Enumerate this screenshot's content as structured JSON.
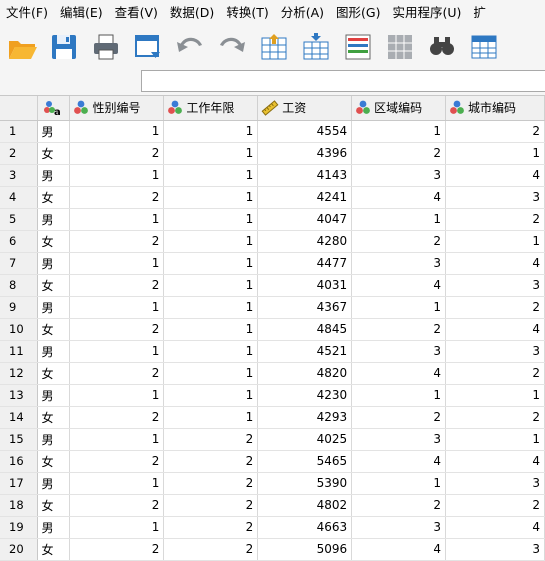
{
  "menu": [
    "文件(F)",
    "编辑(E)",
    "查看(V)",
    "数据(D)",
    "转换(T)",
    "分析(A)",
    "图形(G)",
    "实用程序(U)",
    "扩"
  ],
  "toolbar": [
    {
      "name": "open-folder-icon"
    },
    {
      "name": "save-icon"
    },
    {
      "name": "print-icon"
    },
    {
      "name": "dialog-recall-icon"
    },
    {
      "name": "undo-icon"
    },
    {
      "name": "redo-icon"
    },
    {
      "name": "goto-case-icon"
    },
    {
      "name": "goto-variable-icon"
    },
    {
      "name": "variables-icon"
    },
    {
      "name": "insert-cases-icon"
    },
    {
      "name": "find-icon"
    },
    {
      "name": "split-file-icon"
    }
  ],
  "columns": [
    {
      "label": "",
      "type": "string-nominal"
    },
    {
      "label": "性别编号",
      "type": "nominal"
    },
    {
      "label": "工作年限",
      "type": "nominal"
    },
    {
      "label": "工资",
      "type": "scale"
    },
    {
      "label": "区域编码",
      "type": "nominal"
    },
    {
      "label": "城市编码",
      "type": "nominal"
    }
  ],
  "rows": [
    {
      "n": "1",
      "c": [
        "男",
        "1",
        "1",
        "4554",
        "1",
        "2"
      ]
    },
    {
      "n": "2",
      "c": [
        "女",
        "2",
        "1",
        "4396",
        "2",
        "1"
      ]
    },
    {
      "n": "3",
      "c": [
        "男",
        "1",
        "1",
        "4143",
        "3",
        "4"
      ]
    },
    {
      "n": "4",
      "c": [
        "女",
        "2",
        "1",
        "4241",
        "4",
        "3"
      ]
    },
    {
      "n": "5",
      "c": [
        "男",
        "1",
        "1",
        "4047",
        "1",
        "2"
      ]
    },
    {
      "n": "6",
      "c": [
        "女",
        "2",
        "1",
        "4280",
        "2",
        "1"
      ]
    },
    {
      "n": "7",
      "c": [
        "男",
        "1",
        "1",
        "4477",
        "3",
        "4"
      ]
    },
    {
      "n": "8",
      "c": [
        "女",
        "2",
        "1",
        "4031",
        "4",
        "3"
      ]
    },
    {
      "n": "9",
      "c": [
        "男",
        "1",
        "1",
        "4367",
        "1",
        "2"
      ]
    },
    {
      "n": "10",
      "c": [
        "女",
        "2",
        "1",
        "4845",
        "2",
        "4"
      ]
    },
    {
      "n": "11",
      "c": [
        "男",
        "1",
        "1",
        "4521",
        "3",
        "3"
      ]
    },
    {
      "n": "12",
      "c": [
        "女",
        "2",
        "1",
        "4820",
        "4",
        "2"
      ]
    },
    {
      "n": "13",
      "c": [
        "男",
        "1",
        "1",
        "4230",
        "1",
        "1"
      ]
    },
    {
      "n": "14",
      "c": [
        "女",
        "2",
        "1",
        "4293",
        "2",
        "2"
      ]
    },
    {
      "n": "15",
      "c": [
        "男",
        "1",
        "2",
        "4025",
        "3",
        "1"
      ]
    },
    {
      "n": "16",
      "c": [
        "女",
        "2",
        "2",
        "5465",
        "4",
        "4"
      ]
    },
    {
      "n": "17",
      "c": [
        "男",
        "1",
        "2",
        "5390",
        "1",
        "3"
      ]
    },
    {
      "n": "18",
      "c": [
        "女",
        "2",
        "2",
        "4802",
        "2",
        "2"
      ]
    },
    {
      "n": "19",
      "c": [
        "男",
        "1",
        "2",
        "4663",
        "3",
        "4"
      ]
    },
    {
      "n": "20",
      "c": [
        "女",
        "2",
        "2",
        "5096",
        "4",
        "3"
      ]
    }
  ]
}
